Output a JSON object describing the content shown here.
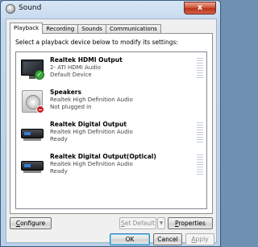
{
  "window": {
    "title": "Sound",
    "close_label": "x",
    "app_icon": "speaker-icon"
  },
  "tabs": [
    {
      "label": "Playback",
      "active": true
    },
    {
      "label": "Recording",
      "active": false
    },
    {
      "label": "Sounds",
      "active": false
    },
    {
      "label": "Communications",
      "active": false
    }
  ],
  "instruction": "Select a playback device below to modify its settings:",
  "devices": [
    {
      "name": "Realtek HDMI Output",
      "description": "2- ATI HDMI Audio",
      "status": "Default Device",
      "icon": "monitor-icon",
      "badge": "checkmark-badge-icon",
      "badge_color": "#3aa638"
    },
    {
      "name": "Speakers",
      "description": "Realtek High Definition Audio",
      "status": "Not plugged in",
      "icon": "speaker-icon",
      "badge": "unplugged-badge-icon",
      "badge_color": "#cc2222"
    },
    {
      "name": "Realtek Digital Output",
      "description": "Realtek High Definition Audio",
      "status": "Ready",
      "icon": "digital-output-icon"
    },
    {
      "name": "Realtek Digital Output(Optical)",
      "description": "Realtek High Definition Audio",
      "status": "Ready",
      "icon": "digital-output-icon"
    }
  ],
  "buttons": {
    "configure": {
      "mnemonic": "C",
      "rest": "onfigure"
    },
    "set_default": {
      "mnemonic": "S",
      "rest": "et Default"
    },
    "set_default_arrow": "▼",
    "properties": {
      "mnemonic": "P",
      "rest": "roperties"
    },
    "ok": "OK",
    "cancel": "Cancel",
    "apply": {
      "mnemonic": "A",
      "rest": "pply"
    }
  }
}
